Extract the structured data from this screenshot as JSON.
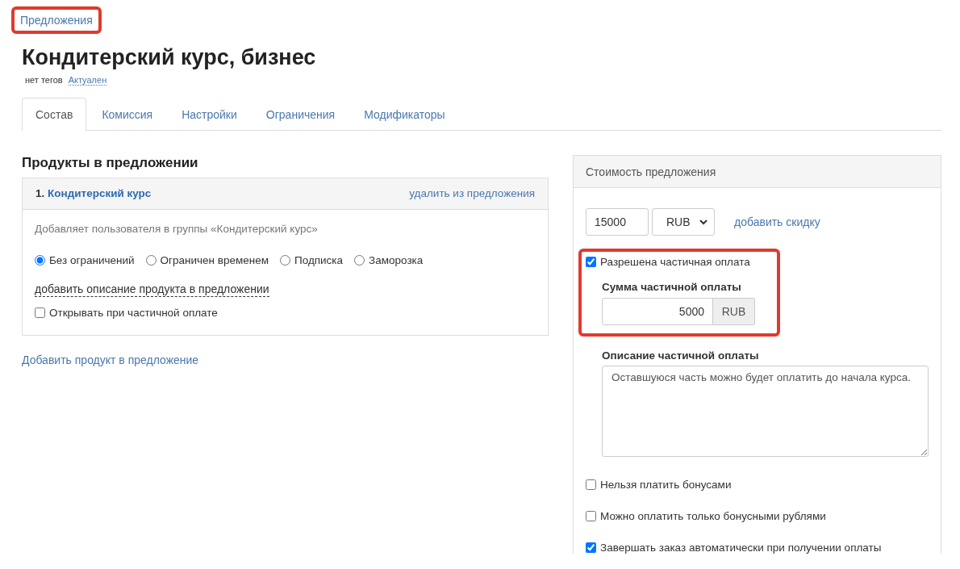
{
  "breadcrumb": "Предложения",
  "title": "Кондитерский курс, бизнес",
  "tags": {
    "label": "нет тегов",
    "status": "Актуален"
  },
  "tabs": [
    {
      "label": "Состав",
      "selected": true
    },
    {
      "label": "Комиссия",
      "selected": false
    },
    {
      "label": "Настройки",
      "selected": false
    },
    {
      "label": "Ограничения",
      "selected": false
    },
    {
      "label": "Модификаторы",
      "selected": false
    }
  ],
  "products": {
    "heading": "Продукты в предложении",
    "items": [
      {
        "number": "1.",
        "name": "Кондитерский курс",
        "remove": "удалить из предложения",
        "description": "Добавляет пользователя в группы «Кондитерский курс»",
        "access": [
          {
            "label": "Без ограничений",
            "selected": true
          },
          {
            "label": "Ограничен временем",
            "selected": false
          },
          {
            "label": "Подписка",
            "selected": false
          },
          {
            "label": "Заморозка",
            "selected": false
          }
        ],
        "add_description": "добавить описание продукта в предложении",
        "open_on_partial": {
          "label": "Открывать при частичной оплате",
          "checked": false
        }
      }
    ],
    "add_product": "Добавить продукт в предложение"
  },
  "price": {
    "heading": "Стоимость предложения",
    "amount": "15000",
    "currency": "RUB",
    "add_discount": "добавить скидку",
    "partial": {
      "label": "Разрешена частичная оплата",
      "checked": true,
      "sum_label": "Сумма частичной оплаты",
      "sum": "5000",
      "sum_currency": "RUB",
      "description_label": "Описание частичной оплаты",
      "description": "Оставшуюся часть можно будет оплатить до начала курса."
    },
    "options": [
      {
        "label": "Нельзя платить бонусами",
        "checked": false
      },
      {
        "label": "Можно оплатить только бонусными рублями",
        "checked": false
      },
      {
        "label": "Завершать заказ автоматически при получении оплаты",
        "checked": true
      }
    ]
  }
}
